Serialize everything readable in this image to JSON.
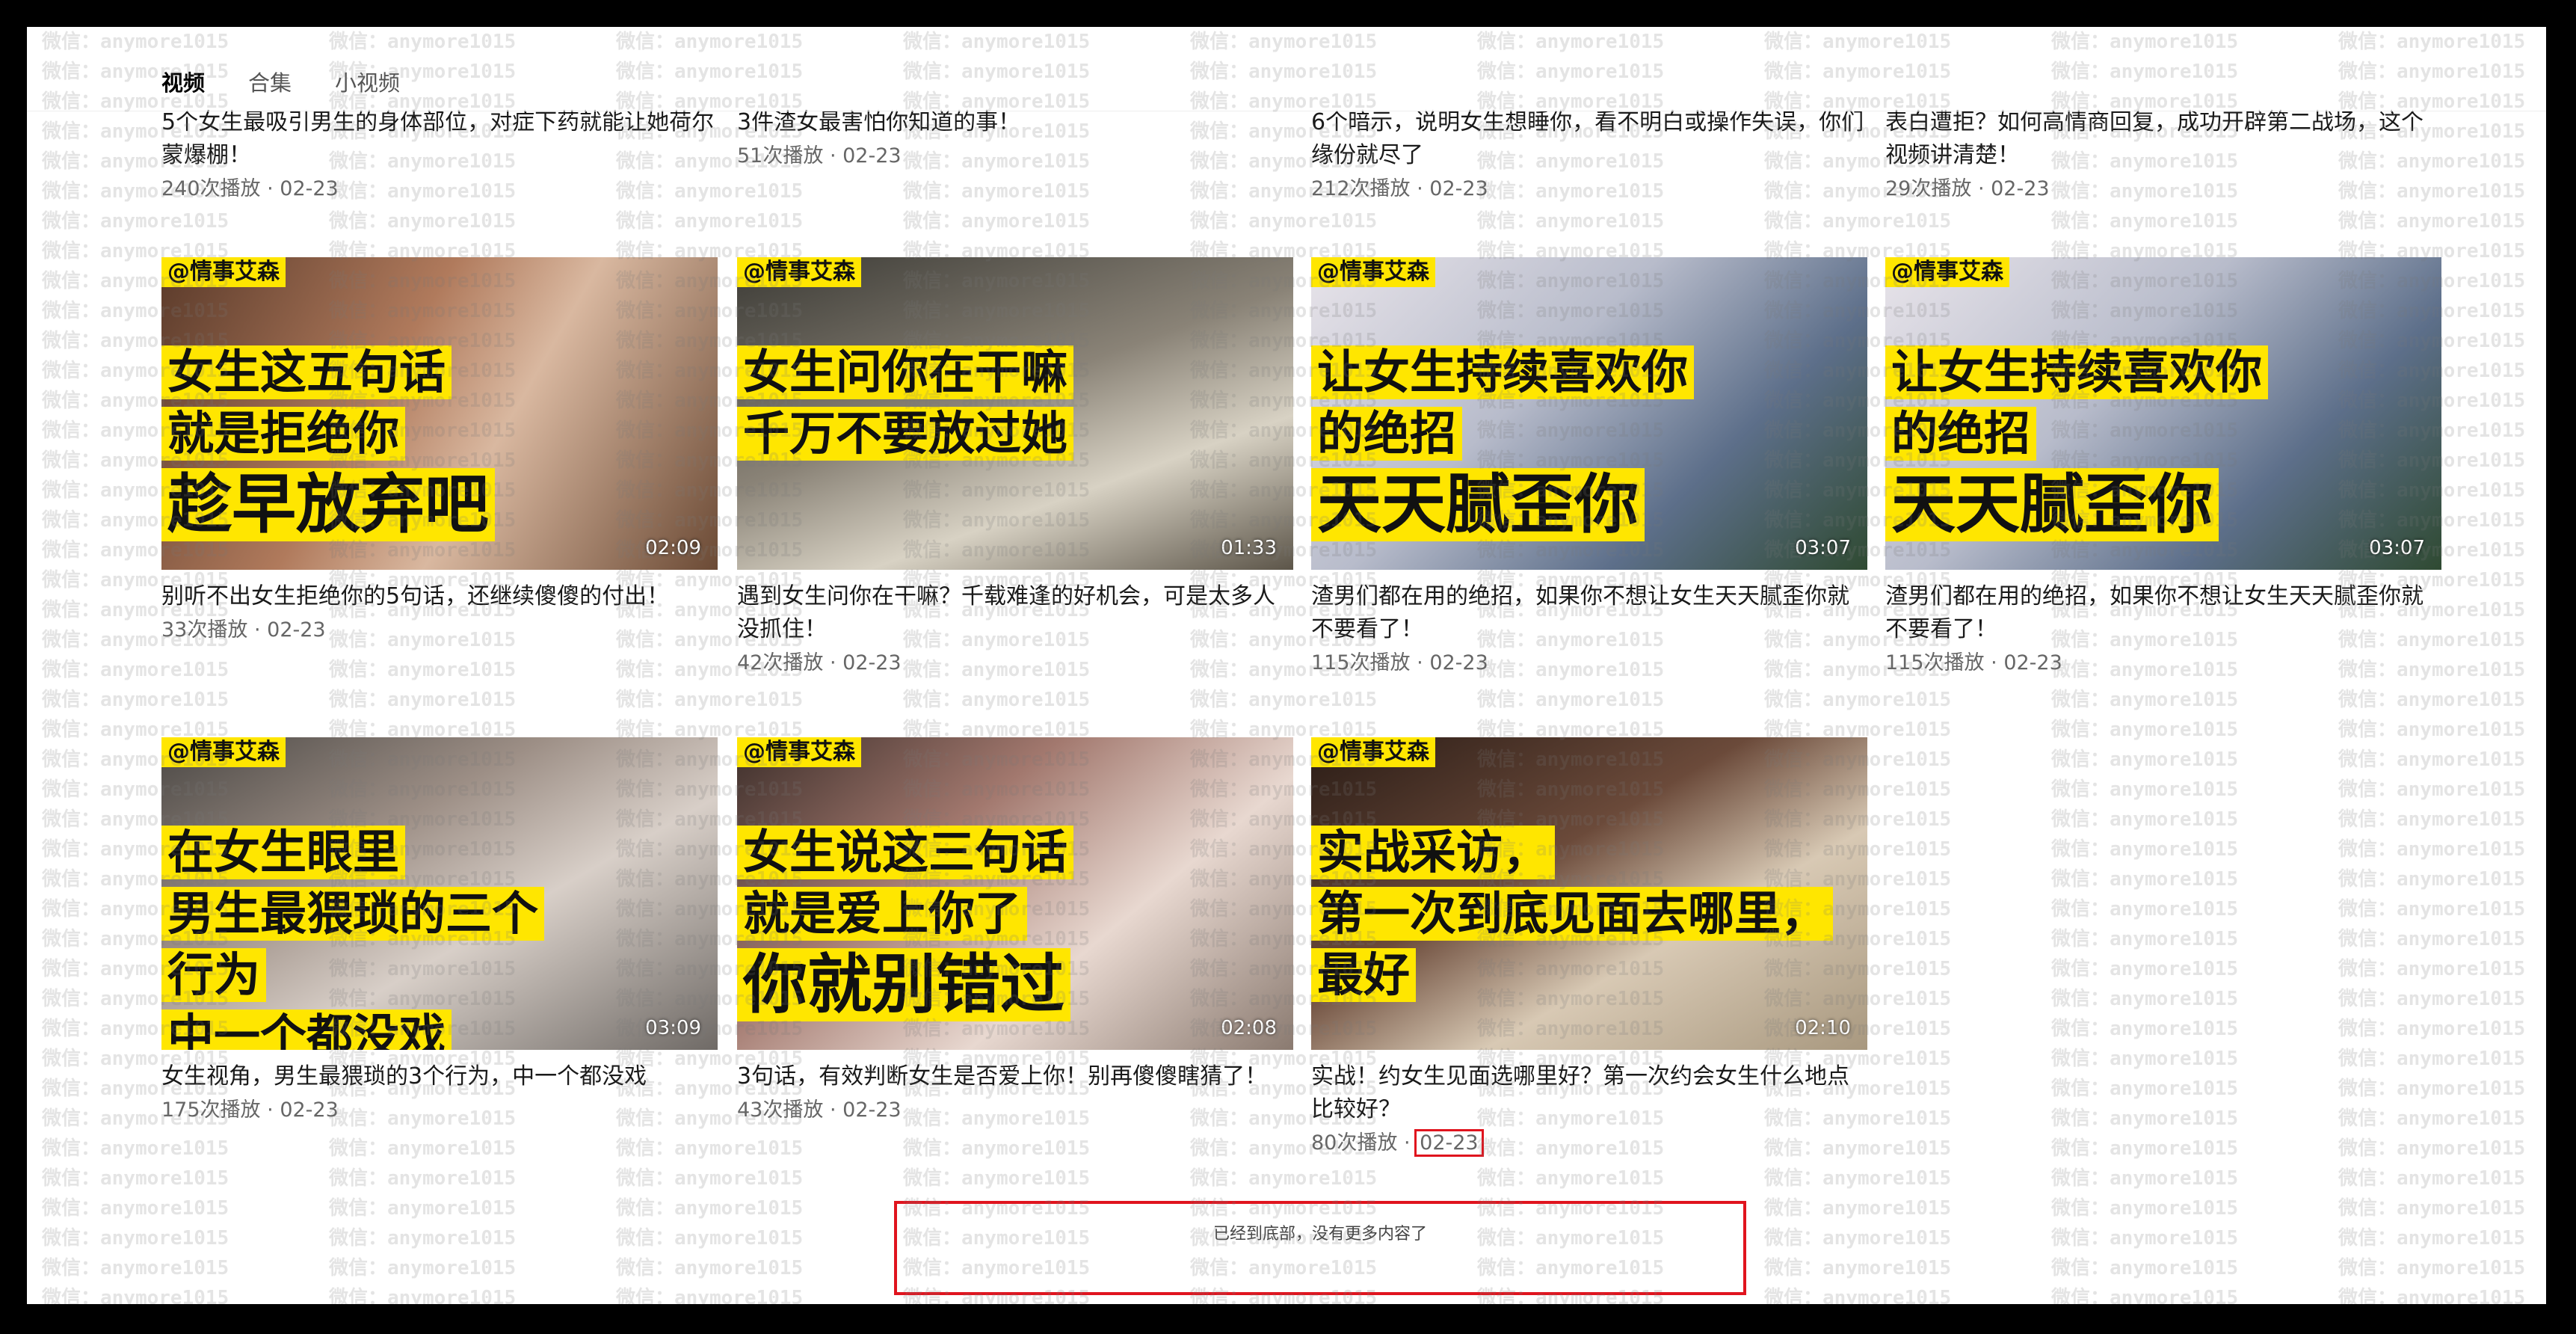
{
  "tabs": [
    {
      "label": "视频",
      "active": true
    },
    {
      "label": "合集",
      "active": false
    },
    {
      "label": "小视频",
      "active": false
    }
  ],
  "watermark_text": "微信：anymore1015",
  "partial_row": [
    {
      "title": "5个女生最吸引男生的身体部位，对症下药就能让她荷尔蒙爆棚！",
      "meta": "240次播放 · 02-23"
    },
    {
      "title": "3件渣女最害怕你知道的事！",
      "meta": "51次播放 · 02-23"
    },
    {
      "title": "6个暗示，说明女生想睡你，看不明白或操作失误，你们缘份就尽了",
      "meta": "212次播放 · 02-23"
    },
    {
      "title": "表白遭拒？如何高情商回复，成功开辟第二战场，这个视频讲清楚！",
      "meta": "29次播放 · 02-23"
    }
  ],
  "videos": [
    {
      "brand": "@情事艾森",
      "captions": [
        "女生这五句话",
        "就是拒绝你"
      ],
      "big": "趁早放弃吧",
      "duration": "02:09",
      "title": "别听不出女生拒绝你的5句话，还继续傻傻的付出！",
      "plays": "33次播放",
      "date": "02-23"
    },
    {
      "brand": "@情事艾森",
      "captions": [
        "女生问你在干嘛",
        "千万不要放过她"
      ],
      "big": "",
      "duration": "01:33",
      "title": "遇到女生问你在干嘛？千载难逢的好机会，可是太多人没抓住！",
      "plays": "42次播放",
      "date": "02-23"
    },
    {
      "brand": "@情事艾森",
      "captions": [
        "让女生持续喜欢你",
        "的绝招"
      ],
      "big": "天天腻歪你",
      "duration": "03:07",
      "title": "渣男们都在用的绝招，如果你不想让女生天天腻歪你就不要看了！",
      "plays": "115次播放",
      "date": "02-23"
    },
    {
      "brand": "@情事艾森",
      "captions": [
        "让女生持续喜欢你",
        "的绝招"
      ],
      "big": "天天腻歪你",
      "duration": "03:07",
      "title": "渣男们都在用的绝招，如果你不想让女生天天腻歪你就不要看了！",
      "plays": "115次播放",
      "date": "02-23"
    },
    {
      "brand": "@情事艾森",
      "captions": [
        "在女生眼里",
        "男生最猥琐的三个",
        "行为",
        "中一个都没戏"
      ],
      "big": "",
      "duration": "03:09",
      "title": "女生视角，男生最猥琐的3个行为，中一个都没戏",
      "plays": "175次播放",
      "date": "02-23"
    },
    {
      "brand": "@情事艾森",
      "captions": [
        "女生说这三句话",
        "就是爱上你了"
      ],
      "big": "你就别错过",
      "duration": "02:08",
      "title": "3句话，有效判断女生是否爱上你！别再傻傻瞎猜了！",
      "plays": "43次播放",
      "date": "02-23"
    },
    {
      "brand": "@情事艾森",
      "captions": [
        "实战采访，",
        "第一次到底见面去哪里，",
        "最好"
      ],
      "big": "",
      "duration": "02:10",
      "title": "实战！约女生见面选哪里好？第一次约会女生什么地点比较好？",
      "plays": "80次播放",
      "date": "02-23"
    }
  ],
  "end_message": "已经到底部，没有更多内容了",
  "colors": {
    "caption_bg": "#ffe600",
    "highlight_border": "#e0141e"
  }
}
